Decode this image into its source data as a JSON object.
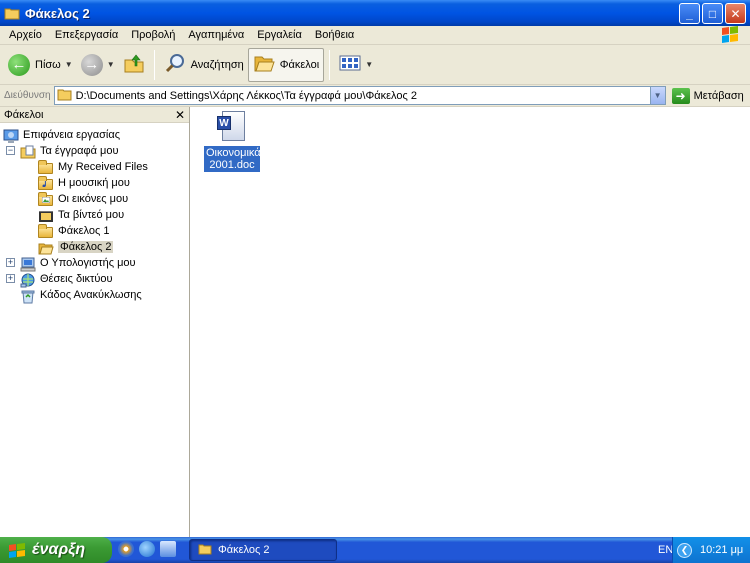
{
  "window": {
    "title": "Φάκελος 2",
    "controls": {
      "minimize": "_",
      "maximize": "□",
      "close": "✕"
    }
  },
  "menu": [
    "Αρχείο",
    "Επεξεργασία",
    "Προβολή",
    "Αγαπημένα",
    "Εργαλεία",
    "Βοήθεια"
  ],
  "toolbar": {
    "back_label": "Πίσω",
    "search_label": "Αναζήτηση",
    "folders_label": "Φάκελοι",
    "views_icon": "views-icon"
  },
  "address": {
    "label": "Διεύθυνση",
    "path": "D:\\Documents and Settings\\Χάρης Λέκκος\\Τα έγγραφά μου\\Φάκελος 2",
    "go_label": "Μετάβαση"
  },
  "folders_pane": {
    "title": "Φάκελοι",
    "close": "✕",
    "tree": [
      {
        "label": "Επιφάνεια εργασίας",
        "icon": "desktop-icon"
      },
      {
        "label": "Τα έγγραφά μου",
        "icon": "my-documents-icon",
        "expander": "−"
      },
      {
        "label": "My Received Files",
        "icon": "folder-icon"
      },
      {
        "label": "Η μουσική μου",
        "icon": "music-folder-icon"
      },
      {
        "label": "Οι εικόνες μου",
        "icon": "pictures-folder-icon"
      },
      {
        "label": "Τα βίντεό μου",
        "icon": "video-folder-icon"
      },
      {
        "label": "Φάκελος 1",
        "icon": "folder-icon"
      },
      {
        "label": "Φάκελος 2",
        "icon": "folder-open-icon",
        "selected": true
      },
      {
        "label": "Ο Υπολογιστής μου",
        "icon": "my-computer-icon",
        "expander": "+"
      },
      {
        "label": "Θέσεις δικτύου",
        "icon": "network-places-icon",
        "expander": "+"
      },
      {
        "label": "Κάδος Ανακύκλωσης",
        "icon": "recycle-bin-icon"
      }
    ]
  },
  "content": {
    "files": [
      {
        "name_line1": "Οικονομικά",
        "name_line2": "2001.doc",
        "icon": "word-document-icon",
        "selected": true
      }
    ]
  },
  "taskbar": {
    "start_label": "έναρξη",
    "task_label": "Φάκελος 2",
    "language": "EN",
    "clock": "10:21 μμ"
  },
  "colors": {
    "titlebar": "#0054e3",
    "selection": "#316ac5",
    "start_button": "#3b9b34",
    "taskbar": "#2157d7"
  }
}
